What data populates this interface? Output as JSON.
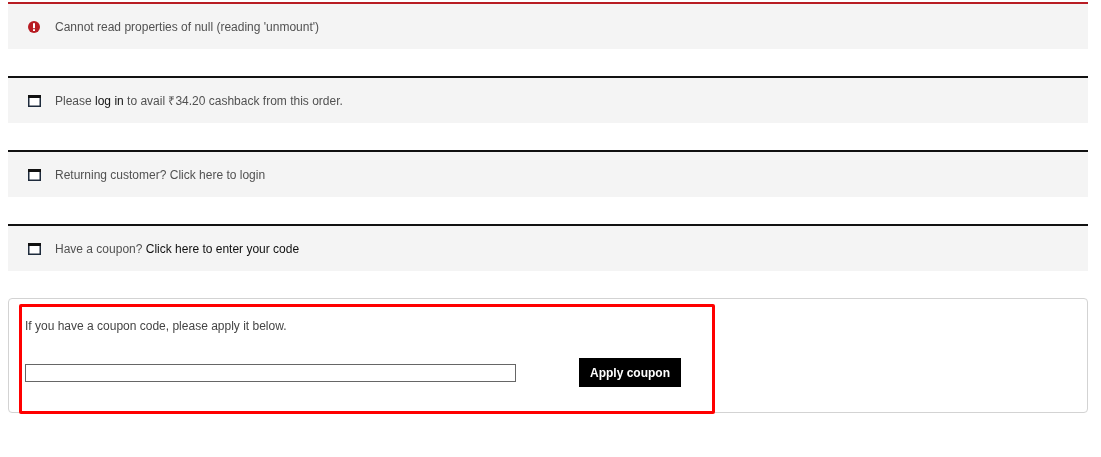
{
  "notices": [
    {
      "kind": "error",
      "text": "Cannot read properties of null (reading 'unmount')"
    },
    {
      "kind": "info",
      "text": "Please ",
      "link": "log in",
      "text_after": " to avail ₹34.20 cashback from this order."
    },
    {
      "kind": "info",
      "text": "Returning customer? Click here to login"
    },
    {
      "kind": "info",
      "text": "Have a coupon? ",
      "link": "Click here to enter your code"
    }
  ],
  "coupon_form": {
    "instructions": "If you have a coupon code, please apply it below.",
    "button": "Apply coupon",
    "highlighted": true
  }
}
